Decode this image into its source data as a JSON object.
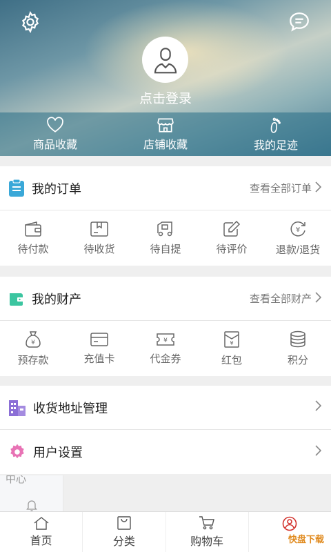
{
  "header": {
    "login_text": "点击登录",
    "favorites": [
      {
        "label": "商品收藏",
        "icon": "heart-icon"
      },
      {
        "label": "店铺收藏",
        "icon": "store-icon"
      },
      {
        "label": "我的足迹",
        "icon": "footprint-icon"
      }
    ]
  },
  "orders": {
    "title": "我的订单",
    "more": "查看全部订单",
    "items": [
      {
        "label": "待付款",
        "icon": "wallet-icon"
      },
      {
        "label": "待收货",
        "icon": "package-icon"
      },
      {
        "label": "待自提",
        "icon": "truck-icon"
      },
      {
        "label": "待评价",
        "icon": "edit-icon"
      },
      {
        "label": "退款/退货",
        "icon": "refund-icon"
      }
    ]
  },
  "assets": {
    "title": "我的财产",
    "more": "查看全部财产",
    "items": [
      {
        "label": "预存款",
        "icon": "money-bag-icon"
      },
      {
        "label": "充值卡",
        "icon": "card-icon"
      },
      {
        "label": "代金券",
        "icon": "voucher-icon"
      },
      {
        "label": "红包",
        "icon": "red-envelope-icon"
      },
      {
        "label": "积分",
        "icon": "coins-icon"
      }
    ]
  },
  "menu": {
    "address": "收货地址管理",
    "settings": "用户设置"
  },
  "ghost": {
    "text": "中心"
  },
  "nav": [
    {
      "label": "首页",
      "icon": "home-icon"
    },
    {
      "label": "分类",
      "icon": "bag-icon"
    },
    {
      "label": "购物车",
      "icon": "cart-icon"
    },
    {
      "label": "",
      "icon": "user-icon"
    }
  ],
  "watermark": "快盘下载",
  "colors": {
    "accent": "#d2322d",
    "orders_icon": "#3aa8d8",
    "assets_icon": "#3bc5a0",
    "address_icon": "#8b6fd6",
    "settings_icon": "#e873b5"
  }
}
